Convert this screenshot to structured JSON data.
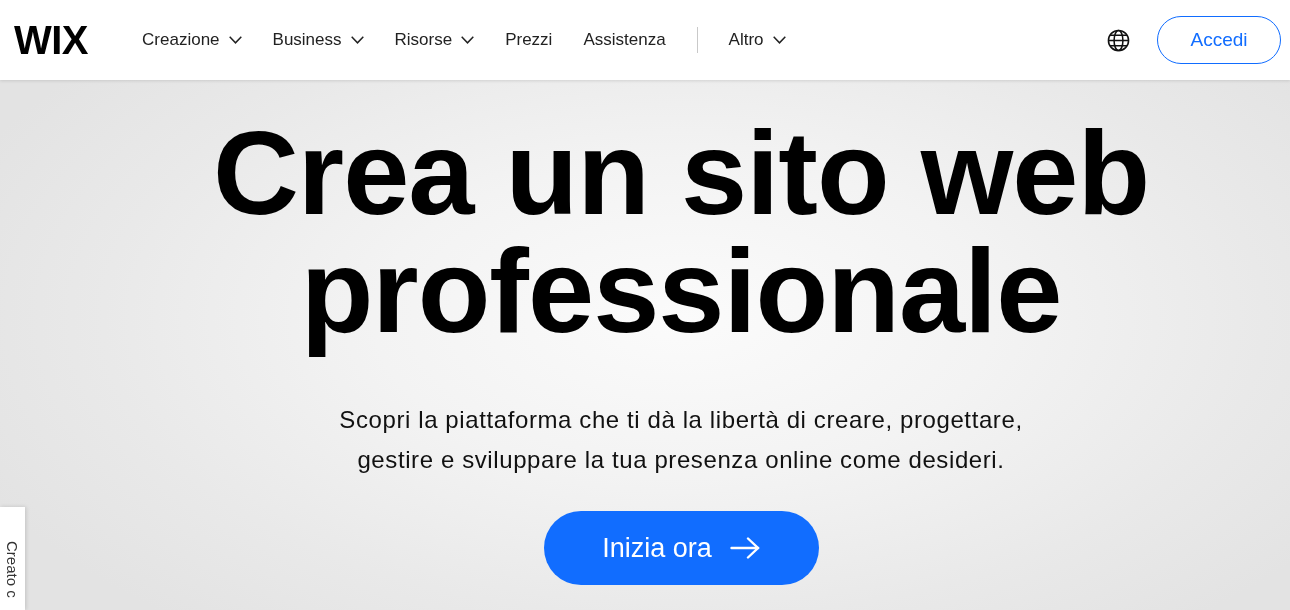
{
  "header": {
    "logo": "WIX",
    "nav": [
      {
        "label": "Creazione",
        "dropdown": true
      },
      {
        "label": "Business",
        "dropdown": true
      },
      {
        "label": "Risorse",
        "dropdown": true
      },
      {
        "label": "Prezzi",
        "dropdown": false
      },
      {
        "label": "Assistenza",
        "dropdown": false
      }
    ],
    "more": {
      "label": "Altro",
      "dropdown": true
    },
    "login": "Accedi"
  },
  "hero": {
    "title": "Crea un sito web professionale",
    "subtitle": "Scopri la piattaforma che ti dà la libertà di creare, progettare, gestire e sviluppare la tua presenza online come desideri.",
    "cta": "Inizia ora"
  },
  "side_tab": {
    "label": "Creato c"
  }
}
